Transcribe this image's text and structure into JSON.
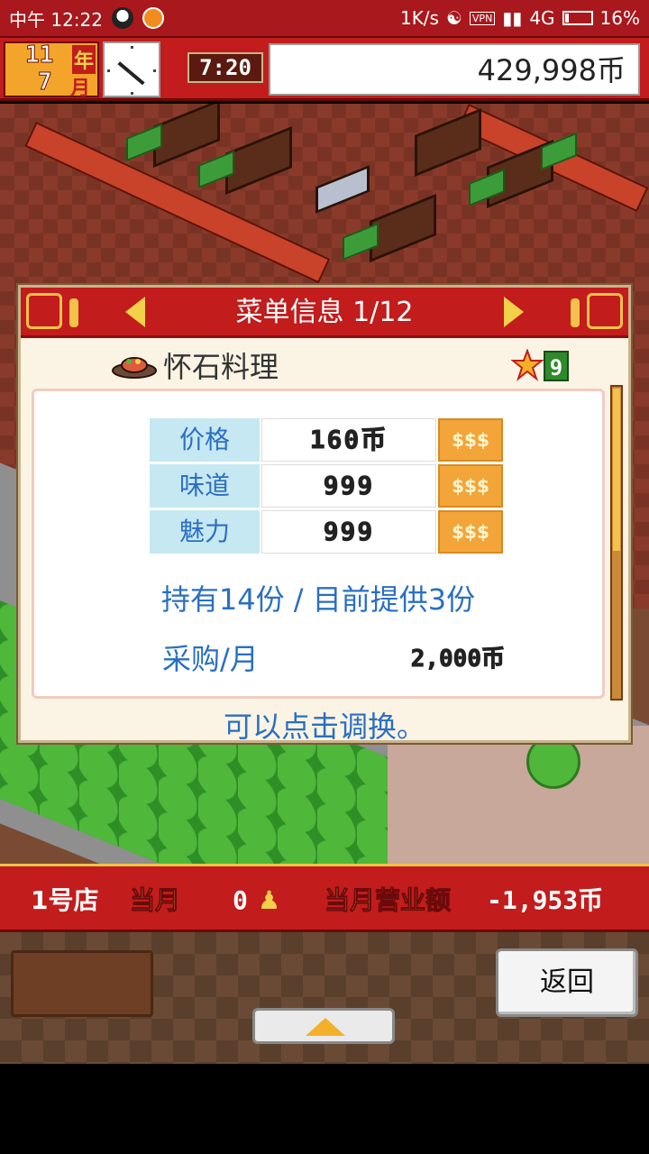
{
  "status_bar": {
    "time": "中午 12:22",
    "network_speed": "1K/s",
    "vpn_label": "VPN",
    "signal": "4G",
    "battery_level": 0.16,
    "battery_text": "16%"
  },
  "header": {
    "year_num": "11",
    "year_label": "年",
    "month_num": "7",
    "month_label": "月",
    "time": "7:20",
    "money": "429,998币"
  },
  "dialog": {
    "title": "菜单信息 1/12",
    "dish_name": "怀石料理",
    "star_count": "9",
    "stats": [
      {
        "label": "价格",
        "value": "160币",
        "button": "$$$"
      },
      {
        "label": "味道",
        "value": "999",
        "button": "$$$"
      },
      {
        "label": "魅力",
        "value": "999",
        "button": "$$$"
      }
    ],
    "stock_text": "持有14份 / 目前提供3份",
    "purchase_label": "采购/月",
    "purchase_value": "2,000币",
    "hint": "可以点击调换。",
    "scroll_position": 0
  },
  "info_bar": {
    "store": "1号店",
    "month": "当月",
    "visitors": "0",
    "person_icon": "person-icon",
    "sales_label": "当月营业额",
    "sales_value": "-1,953币"
  },
  "controls": {
    "back_label": "返回",
    "expand_icon": "triangle-up-icon"
  },
  "colors": {
    "header_red": "#c21c1c",
    "link_blue": "#2a6fc2",
    "gold": "#f3d04a",
    "stat_label_bg": "#c6e8f2"
  }
}
